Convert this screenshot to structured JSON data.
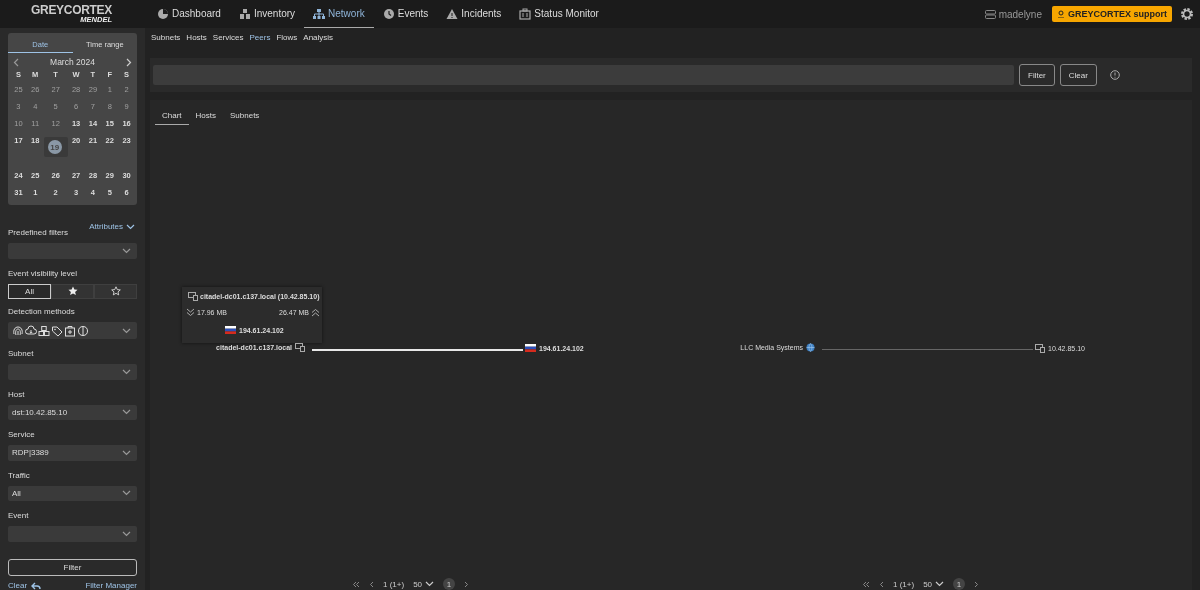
{
  "logo": {
    "name": "GREYCORTEX",
    "subtitle": "MENDEL"
  },
  "nav": [
    {
      "label": "Dashboard",
      "selected": false
    },
    {
      "label": "Inventory",
      "selected": false
    },
    {
      "label": "Network",
      "selected": true
    },
    {
      "label": "Events",
      "selected": false
    },
    {
      "label": "Incidents",
      "selected": false
    },
    {
      "label": "Status Monitor",
      "selected": false
    }
  ],
  "user": "madelyne",
  "support": "GREYCORTEX support",
  "subnav": [
    {
      "label": "Subnets",
      "selected": false
    },
    {
      "label": "Hosts",
      "selected": false
    },
    {
      "label": "Services",
      "selected": false
    },
    {
      "label": "Peers",
      "selected": true
    },
    {
      "label": "Flows",
      "selected": false
    },
    {
      "label": "Analysis",
      "selected": false
    }
  ],
  "search": {
    "buttons": [
      "Filter",
      "Clear"
    ]
  },
  "calendar": {
    "tabs": [
      {
        "label": "Date",
        "selected": true
      },
      {
        "label": "Time range",
        "selected": false
      }
    ],
    "month": "March 2024",
    "weekdays": [
      "S",
      "M",
      "T",
      "W",
      "T",
      "F",
      "S"
    ],
    "days": [
      {
        "label": "25",
        "disabled": true,
        "selected": false
      },
      {
        "label": "26",
        "disabled": true,
        "selected": false
      },
      {
        "label": "27",
        "disabled": true,
        "selected": false
      },
      {
        "label": "28",
        "disabled": true,
        "selected": false
      },
      {
        "label": "29",
        "disabled": true,
        "selected": false
      },
      {
        "label": "1",
        "disabled": true,
        "selected": false
      },
      {
        "label": "2",
        "disabled": true,
        "selected": false
      },
      {
        "label": "3",
        "disabled": true,
        "selected": false
      },
      {
        "label": "4",
        "disabled": true,
        "selected": false
      },
      {
        "label": "5",
        "disabled": true,
        "selected": false
      },
      {
        "label": "6",
        "disabled": true,
        "selected": false
      },
      {
        "label": "7",
        "disabled": true,
        "selected": false
      },
      {
        "label": "8",
        "disabled": true,
        "selected": false
      },
      {
        "label": "9",
        "disabled": true,
        "selected": false
      },
      {
        "label": "10",
        "disabled": true,
        "selected": false
      },
      {
        "label": "11",
        "disabled": true,
        "selected": false
      },
      {
        "label": "12",
        "disabled": true,
        "selected": false
      },
      {
        "label": "13",
        "disabled": false,
        "selected": false
      },
      {
        "label": "14",
        "disabled": false,
        "selected": false
      },
      {
        "label": "15",
        "disabled": false,
        "selected": false
      },
      {
        "label": "16",
        "disabled": false,
        "selected": false
      },
      {
        "label": "17",
        "disabled": false,
        "selected": false
      },
      {
        "label": "18",
        "disabled": false,
        "selected": false
      },
      {
        "label": "19",
        "disabled": false,
        "selected": true
      },
      {
        "label": "20",
        "disabled": false,
        "selected": false
      },
      {
        "label": "21",
        "disabled": false,
        "selected": false
      },
      {
        "label": "22",
        "disabled": false,
        "selected": false
      },
      {
        "label": "23",
        "disabled": false,
        "selected": false
      },
      {
        "label": "24",
        "disabled": false,
        "selected": false
      },
      {
        "label": "25",
        "disabled": false,
        "selected": false
      },
      {
        "label": "26",
        "disabled": false,
        "selected": false
      },
      {
        "label": "27",
        "disabled": false,
        "selected": false
      },
      {
        "label": "28",
        "disabled": false,
        "selected": false
      },
      {
        "label": "29",
        "disabled": false,
        "selected": false
      },
      {
        "label": "30",
        "disabled": false,
        "selected": false
      },
      {
        "label": "31",
        "disabled": false,
        "selected": false
      },
      {
        "label": "1",
        "disabled": false,
        "selected": false
      },
      {
        "label": "2",
        "disabled": false,
        "selected": false
      },
      {
        "label": "3",
        "disabled": false,
        "selected": false
      },
      {
        "label": "4",
        "disabled": false,
        "selected": false
      },
      {
        "label": "5",
        "disabled": false,
        "selected": false
      },
      {
        "label": "6",
        "disabled": false,
        "selected": false
      }
    ]
  },
  "attributes": "Attributes",
  "filters": [
    {
      "label": "Predefined filters",
      "kind": "select"
    },
    {
      "label": "Event visibility level",
      "kind": "segments",
      "options": [
        {
          "kind": "text",
          "label": "All",
          "selected": true
        },
        {
          "kind": "filled-star",
          "selected": false
        },
        {
          "kind": "outline-star",
          "selected": false
        }
      ]
    },
    {
      "label": "Detection methods",
      "kind": "methods"
    },
    {
      "label": "Subnet",
      "kind": "select"
    },
    {
      "label": "Host",
      "kind": "select",
      "value": "dst:10.42.85.10"
    },
    {
      "label": "Service",
      "kind": "select",
      "value": "RDP|3389"
    },
    {
      "label": "Traffic",
      "kind": "select",
      "value": "All"
    },
    {
      "label": "Event",
      "kind": "select"
    }
  ],
  "filter_button": "Filter",
  "clear_link": "Clear",
  "filter_manager": "Filter Manager",
  "chart_tabs": [
    {
      "label": "Chart",
      "selected": true
    },
    {
      "label": "Hosts",
      "selected": false
    },
    {
      "label": "Subnets",
      "selected": false
    }
  ],
  "graphs": [
    {
      "source": {
        "label": "citadel-dc01.c137.local",
        "kind": "host"
      },
      "target": {
        "label": "194.61.24.102",
        "kind": "flag"
      },
      "highlighted": true,
      "tooltip": {
        "title": "citadel-dc01.c137.local (10.42.85.10)",
        "download": "17.96 MB",
        "upload": "26.47 MB",
        "peer": "194.61.24.102"
      },
      "pager": {
        "page": "1 (1+)",
        "per_page": "50",
        "current": "1"
      }
    },
    {
      "source": {
        "label": "LLC Media Systems",
        "kind": "globe"
      },
      "target": {
        "label": "10.42.85.10",
        "kind": "host"
      },
      "highlighted": false,
      "pager": {
        "page": "1 (1+)",
        "per_page": "50",
        "current": "1"
      }
    }
  ]
}
